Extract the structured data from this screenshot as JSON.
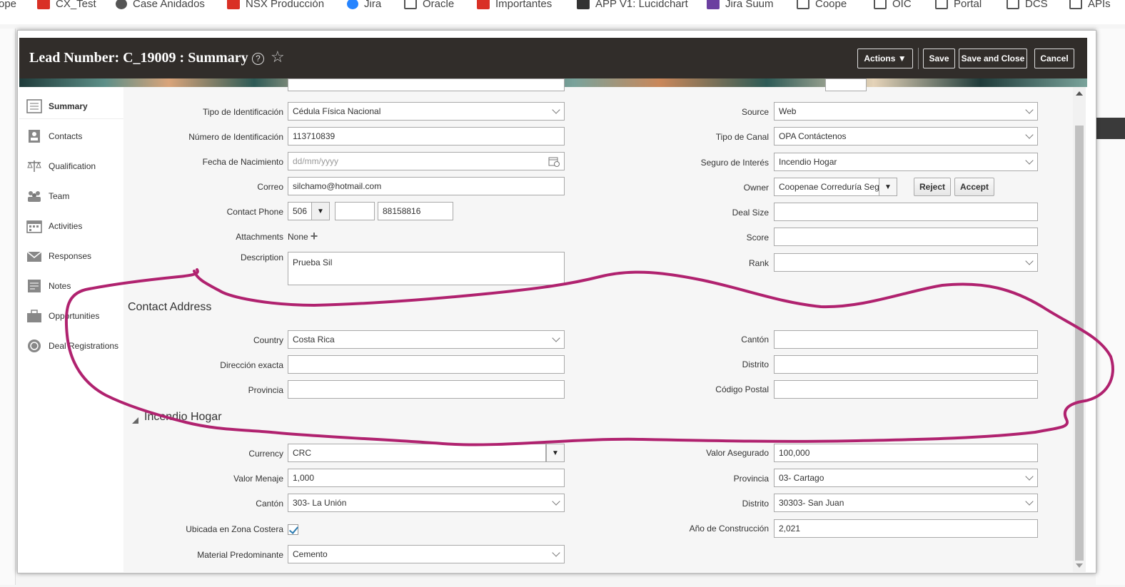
{
  "bookmarks": [
    {
      "label": "ope",
      "icon": "none"
    },
    {
      "label": "CX_Test",
      "icon": "red-square-icon"
    },
    {
      "label": "Case Anidados",
      "icon": "globe-icon"
    },
    {
      "label": "NSX Producción",
      "icon": "red-square-icon"
    },
    {
      "label": "Jira",
      "icon": "jira-icon"
    },
    {
      "label": "Oracle",
      "icon": "folder-icon"
    },
    {
      "label": "Importantes",
      "icon": "red-square-icon"
    },
    {
      "label": "APP V1: Lucidchart",
      "icon": "lucidchart-icon"
    },
    {
      "label": "Jira Suum",
      "icon": "purple-icon"
    },
    {
      "label": "Coope",
      "icon": "folder-icon"
    },
    {
      "label": "OIC",
      "icon": "folder-icon"
    },
    {
      "label": "Portal",
      "icon": "folder-icon"
    },
    {
      "label": "DCS",
      "icon": "folder-icon"
    },
    {
      "label": "APIs",
      "icon": "folder-icon"
    }
  ],
  "dialog": {
    "title": "Lead Number: C_19009 : Summary",
    "help_icon": "?",
    "star_icon": "☆",
    "actions_label": "Actions ▼",
    "save_label": "Save",
    "save_close_label": "Save and Close",
    "cancel_label": "Cancel"
  },
  "sidenav": [
    {
      "label": "Summary",
      "icon": "summary-icon",
      "active": true
    },
    {
      "label": "Contacts",
      "icon": "contacts-icon"
    },
    {
      "label": "Qualification",
      "icon": "scales-icon"
    },
    {
      "label": "Team",
      "icon": "team-icon"
    },
    {
      "label": "Activities",
      "icon": "calendar-icon"
    },
    {
      "label": "Responses",
      "icon": "envelope-icon"
    },
    {
      "label": "Notes",
      "icon": "note-icon"
    },
    {
      "label": "Opportunities",
      "icon": "briefcase-icon"
    },
    {
      "label": "Deal Registrations",
      "icon": "badge-icon"
    }
  ],
  "left_fields": {
    "tipo_id": {
      "label": "Tipo de Identificación",
      "value": "Cédula Física Nacional"
    },
    "numero_id": {
      "label": "Número de Identificación",
      "value": "113710839"
    },
    "fecha_nac": {
      "label": "Fecha de Nacimiento",
      "placeholder": "dd/mm/yyyy"
    },
    "correo": {
      "label": "Correo",
      "value": "silchamo@hotmail.com"
    },
    "phone": {
      "label": "Contact Phone",
      "country_code": "506",
      "area": "",
      "number": "88158816"
    },
    "attachments": {
      "label": "Attachments",
      "value": "None"
    },
    "description": {
      "label": "Description",
      "value": "Prueba Sil"
    }
  },
  "right_fields": {
    "source": {
      "label": "Source",
      "value": "Web"
    },
    "tipo_canal": {
      "label": "Tipo de Canal",
      "value": "OPA Contáctenos"
    },
    "seguro": {
      "label": "Seguro de Interés",
      "value": "Incendio Hogar"
    },
    "owner": {
      "label": "Owner",
      "value": "Coopenae Correduría Seg"
    },
    "reject_label": "Reject",
    "accept_label": "Accept",
    "deal_size": {
      "label": "Deal Size",
      "value": ""
    },
    "score": {
      "label": "Score",
      "value": ""
    },
    "rank": {
      "label": "Rank",
      "value": ""
    }
  },
  "contact_address": {
    "title": "Contact Address",
    "country": {
      "label": "Country",
      "value": "Costa Rica"
    },
    "direccion": {
      "label": "Dirección exacta",
      "value": ""
    },
    "provincia": {
      "label": "Provincia",
      "value": ""
    },
    "canton": {
      "label": "Cantón",
      "value": ""
    },
    "distrito": {
      "label": "Distrito",
      "value": ""
    },
    "codigo_postal": {
      "label": "Código Postal",
      "value": ""
    }
  },
  "incendio": {
    "title": "Incendio Hogar",
    "currency": {
      "label": "Currency",
      "value": "CRC"
    },
    "valor_menaje": {
      "label": "Valor Menaje",
      "value": "1,000"
    },
    "canton": {
      "label": "Cantón",
      "value": "303- La Unión"
    },
    "zona_costera": {
      "label": "Ubicada en Zona Costera",
      "checked": true
    },
    "material": {
      "label": "Material Predominante",
      "value": "Cemento"
    },
    "valor_asegurado": {
      "label": "Valor Asegurado",
      "value": "100,000"
    },
    "provincia": {
      "label": "Provincia",
      "value": "03- Cartago"
    },
    "distrito": {
      "label": "Distrito",
      "value": "30303- San Juan"
    },
    "anio_construccion": {
      "label": "Año de Construcción",
      "value": "2,021"
    }
  },
  "colors": {
    "header_bg": "#312d2a",
    "annotation_stroke": "#b0226f",
    "checkbox_accent": "#2a7ab0"
  }
}
